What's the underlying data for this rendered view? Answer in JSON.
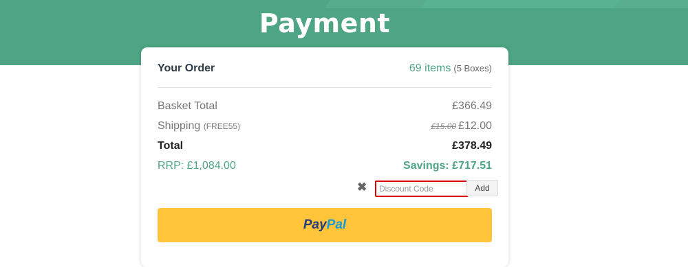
{
  "header": {
    "title": "Payment"
  },
  "order": {
    "title": "Your Order",
    "items_count": "69 items",
    "boxes": "(5 Boxes)",
    "basket_total_label": "Basket Total",
    "basket_total_value": "£366.49",
    "shipping_label": "Shipping",
    "shipping_code": "(FREE55)",
    "shipping_original": "£15.00",
    "shipping_value": "£12.00",
    "total_label": "Total",
    "total_value": "£378.49",
    "rrp": "RRP: £1,084.00",
    "savings": "Savings: £717.51"
  },
  "discount": {
    "placeholder": "Discount Code",
    "value": "",
    "add_label": "Add",
    "remove_icon": "close-x-icon"
  },
  "paypal": {
    "brand_part1": "Pay",
    "brand_part2": "Pal",
    "color": "#ffc439"
  },
  "colors": {
    "accent": "#4da584",
    "highlight_border": "#e00000"
  }
}
